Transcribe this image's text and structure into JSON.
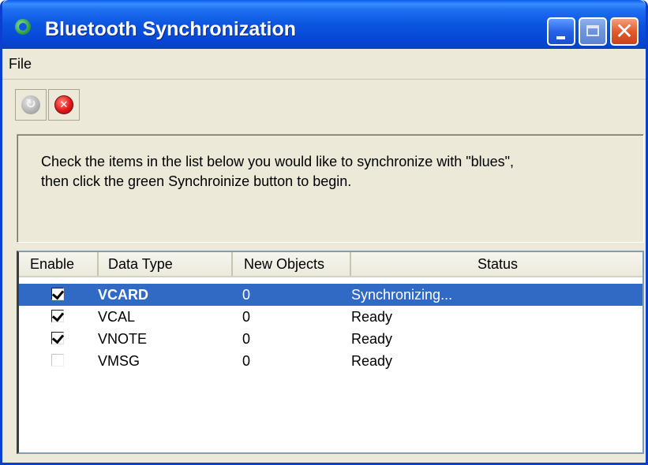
{
  "window": {
    "title": "Bluetooth Synchronization",
    "icon": "sync-app-icon",
    "controls": [
      "minimize-icon",
      "maximize-icon",
      "close-icon"
    ],
    "close_glyph": "✕"
  },
  "menu": {
    "items": [
      {
        "label": "File"
      }
    ]
  },
  "toolbar": {
    "buttons": [
      {
        "name": "synchronize",
        "icon": "sync-icon",
        "enabled": false
      },
      {
        "name": "stop",
        "icon": "stop-icon",
        "enabled": true
      }
    ]
  },
  "instructions": {
    "line1": "Check the items in the list below you would like to synchronize with \"blues\",",
    "line2": "then click the green Synchroinize button to begin."
  },
  "list": {
    "columns": [
      "Enable",
      "Data Type",
      "New Objects",
      "Status"
    ],
    "rows": [
      {
        "enabled": true,
        "type": "VCARD",
        "new_objects": "0",
        "status": "Synchronizing...",
        "selected": true
      },
      {
        "enabled": true,
        "type": "VCAL",
        "new_objects": "0",
        "status": "Ready",
        "selected": false
      },
      {
        "enabled": true,
        "type": "VNOTE",
        "new_objects": "0",
        "status": "Ready",
        "selected": false
      },
      {
        "enabled": false,
        "type": "VMSG",
        "new_objects": "0",
        "status": "Ready",
        "selected": false
      }
    ]
  },
  "colors": {
    "titlebar": "#0b55e0",
    "selection": "#316ac5",
    "window_bg": "#ece9d8",
    "close_button": "#e35a2d"
  }
}
